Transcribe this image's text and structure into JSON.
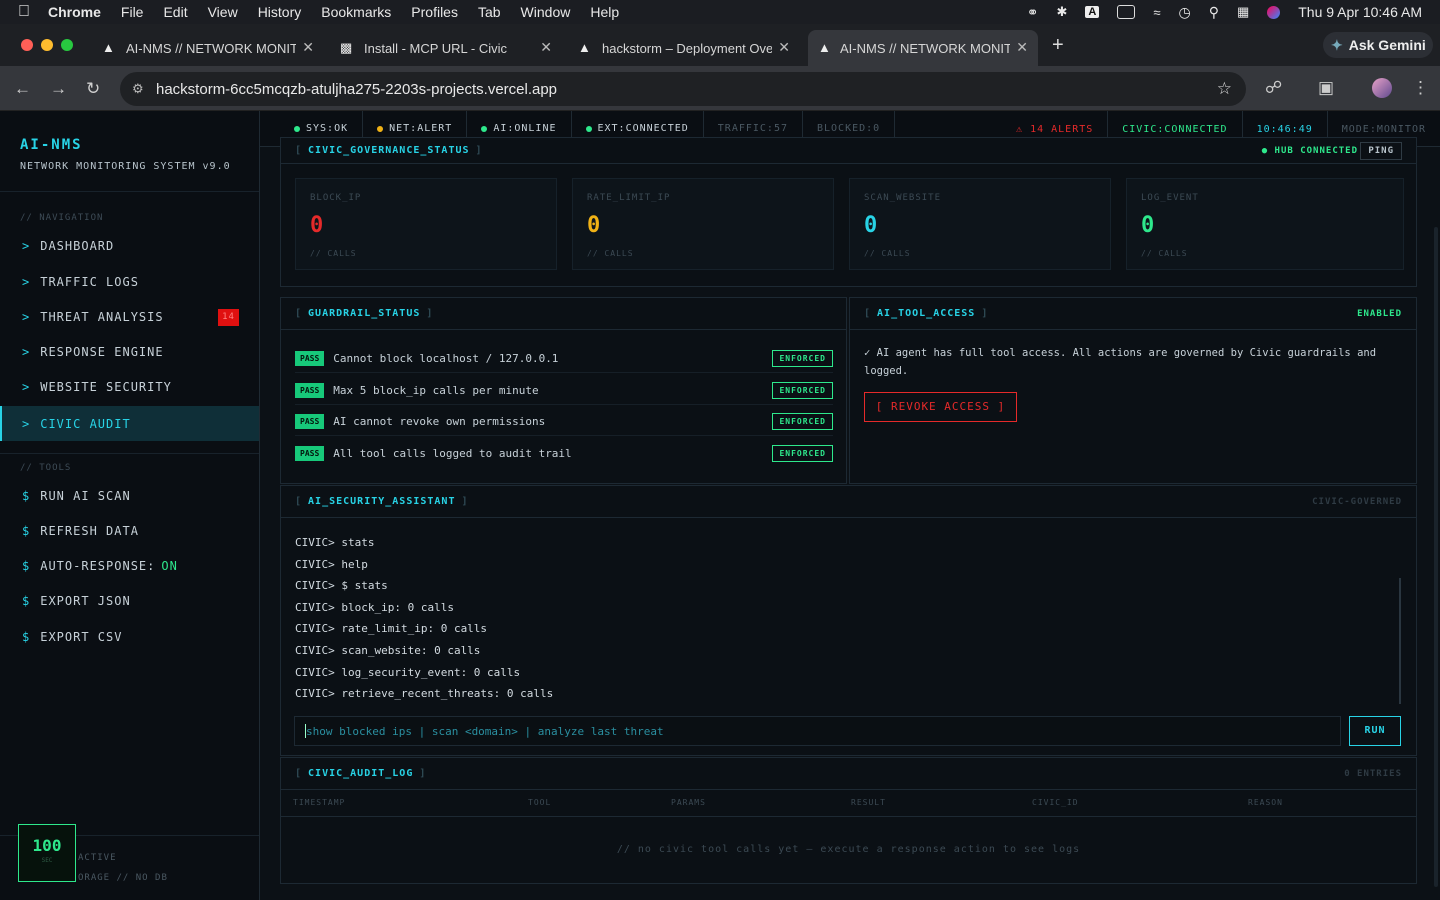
{
  "menubar": {
    "app": "Chrome",
    "items": [
      "File",
      "Edit",
      "View",
      "History",
      "Bookmarks",
      "Profiles",
      "Tab",
      "Window",
      "Help"
    ],
    "clock": "Thu 9 Apr  10:46 AM"
  },
  "browser": {
    "tabs": [
      {
        "title": "AI-NMS // NETWORK MONITO"
      },
      {
        "title": "Install - MCP URL - Civic"
      },
      {
        "title": "hackstorm – Deployment Ove"
      },
      {
        "title": "AI-NMS // NETWORK MONITO"
      }
    ],
    "gemini": "Ask Gemini",
    "url": "hackstorm-6cc5mcqzb-atuljha275-2203s-projects.vercel.app"
  },
  "sidebar": {
    "brand": "AI-NMS",
    "subtitle": "NETWORK MONITORING SYSTEM v9.0",
    "nav_header": "// NAVIGATION",
    "nav": [
      {
        "prefix": ">",
        "label": "DASHBOARD"
      },
      {
        "prefix": ">",
        "label": "TRAFFIC LOGS"
      },
      {
        "prefix": ">",
        "label": "THREAT ANALYSIS",
        "badge": "14"
      },
      {
        "prefix": ">",
        "label": "RESPONSE ENGINE"
      },
      {
        "prefix": ">",
        "label": "WEBSITE SECURITY"
      },
      {
        "prefix": ">",
        "label": "CIVIC AUDIT"
      }
    ],
    "tools_header": "// TOOLS",
    "tools": [
      {
        "prefix": "$",
        "label": "RUN AI SCAN"
      },
      {
        "prefix": "$",
        "label": "REFRESH DATA"
      },
      {
        "prefix": "$",
        "label": "AUTO-RESPONSE:",
        "state": "ON"
      },
      {
        "prefix": "$",
        "label": "EXPORT JSON"
      },
      {
        "prefix": "$",
        "label": "EXPORT CSV"
      }
    ],
    "counter_value": "100",
    "counter_unit": "SEC",
    "footer_line1": "ACTIVE",
    "footer_line2": "ORAGE // NO DB"
  },
  "statusbar": {
    "sys": "SYS:OK",
    "net": "NET:ALERT",
    "ai": "AI:ONLINE",
    "ext": "EXT:CONNECTED",
    "traffic": "TRAFFIC:57",
    "blocked": "BLOCKED:0",
    "alerts": "⚠ 14 ALERTS",
    "civic": "CIVIC:CONNECTED",
    "time": "10:46:49",
    "mode": "MODE:MONITOR"
  },
  "governance": {
    "title": "CIVIC_GOVERNANCE_STATUS",
    "hub": "HUB CONNECTED",
    "ping": "PING",
    "metrics": [
      {
        "label": "BLOCK_IP",
        "value": "0",
        "unit": "// CALLS",
        "color": "#e52a2a"
      },
      {
        "label": "RATE_LIMIT_IP",
        "value": "0",
        "unit": "// CALLS",
        "color": "#f0b216"
      },
      {
        "label": "SCAN_WEBSITE",
        "value": "0",
        "unit": "// CALLS",
        "color": "#28d3e6"
      },
      {
        "label": "LOG_EVENT",
        "value": "0",
        "unit": "// CALLS",
        "color": "#2ee88c"
      }
    ]
  },
  "guardrail": {
    "title": "GUARDRAIL_STATUS",
    "rules": [
      {
        "status": "PASS",
        "text": "Cannot block localhost / 127.0.0.1",
        "tag": "ENFORCED"
      },
      {
        "status": "PASS",
        "text": "Max 5 block_ip calls per minute",
        "tag": "ENFORCED"
      },
      {
        "status": "PASS",
        "text": "AI cannot revoke own permissions",
        "tag": "ENFORCED"
      },
      {
        "status": "PASS",
        "text": "All tool calls logged to audit trail",
        "tag": "ENFORCED"
      }
    ]
  },
  "tool_access": {
    "title": "AI_TOOL_ACCESS",
    "state": "ENABLED",
    "message": "✓ AI agent has full tool access. All actions are governed by Civic guardrails and logged.",
    "revoke": "[ REVOKE ACCESS ]"
  },
  "assistant": {
    "title": "AI_SECURITY_ASSISTANT",
    "tag": "CIVIC-GOVERNED",
    "lines": [
      "CIVIC> stats",
      "CIVIC> help",
      "CIVIC> $ stats",
      "CIVIC> block_ip: 0 calls",
      "CIVIC> rate_limit_ip: 0 calls",
      "CIVIC> scan_website: 0 calls",
      "CIVIC> log_security_event: 0 calls",
      "CIVIC> retrieve_recent_threats: 0 calls"
    ],
    "placeholder": "show blocked ips | scan <domain> | analyze last threat",
    "run": "RUN"
  },
  "audit": {
    "title": "CIVIC_AUDIT_LOG",
    "count": "0 ENTRIES",
    "columns": [
      "TIMESTAMP",
      "TOOL",
      "PARAMS",
      "RESULT",
      "CIVIC_ID",
      "REASON"
    ],
    "empty": "// no civic tool calls yet — execute a response action to see logs"
  }
}
